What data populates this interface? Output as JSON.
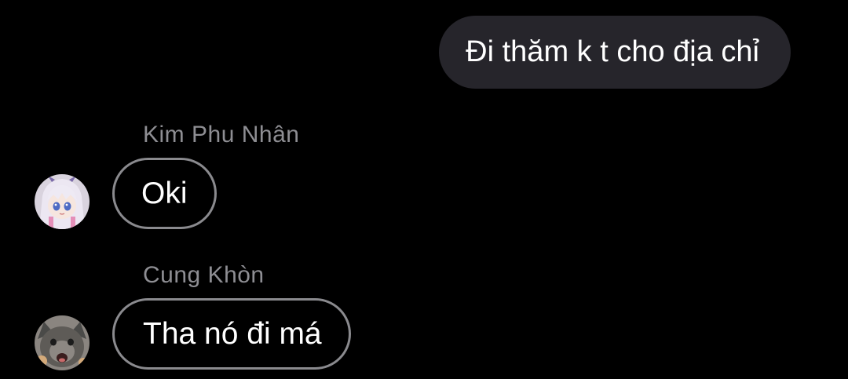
{
  "thread": {
    "outgoing_message": {
      "text": "Đi thăm k t cho địa chỉ"
    },
    "incoming_messages": [
      {
        "sender": "Kim Phu Nhân",
        "avatar_icon": "anime-girl-avatar-icon",
        "text": "Oki"
      },
      {
        "sender": "Cung Khòn",
        "avatar_icon": "kitten-avatar-icon",
        "text": "Tha nó đi má"
      }
    ]
  },
  "colors": {
    "background": "#000000",
    "outgoing_bubble": "#26252b",
    "incoming_border": "#8a8a8e",
    "sender_name": "#8e8e93",
    "text": "#ffffff"
  }
}
